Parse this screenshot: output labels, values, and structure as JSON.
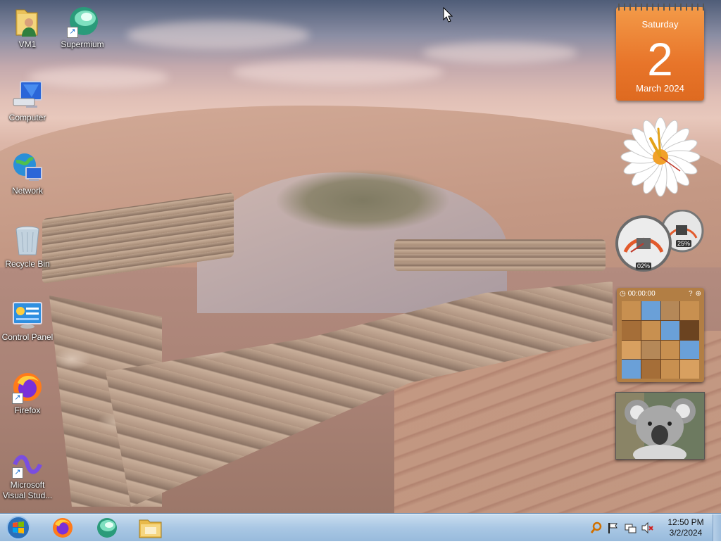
{
  "desktop": {
    "icons": [
      {
        "label": "VM1"
      },
      {
        "label": "Supermium"
      },
      {
        "label": "Computer"
      },
      {
        "label": "Network"
      },
      {
        "label": "Recycle Bin"
      },
      {
        "label": "Control Panel"
      },
      {
        "label": "Firefox"
      },
      {
        "label": "Microsoft Visual Stud..."
      }
    ]
  },
  "gadgets": {
    "calendar": {
      "day_name": "Saturday",
      "day_number": "2",
      "month_year": "March 2024"
    },
    "cpu_meter": {
      "cpu": "02%",
      "memory": "25%"
    },
    "puzzle": {
      "timer": "00:00:00"
    }
  },
  "taskbar": {
    "pinned": [
      "firefox-icon",
      "supermium-icon",
      "file-explorer-icon"
    ],
    "tray_icons": [
      "search-icon",
      "action-center-flag-icon",
      "network-icon",
      "volume-muted-icon"
    ],
    "time": "12:50 PM",
    "date": "3/2/2024"
  },
  "colors": {
    "calendar": "#e8752a",
    "taskbar": "#a9c7e4"
  }
}
